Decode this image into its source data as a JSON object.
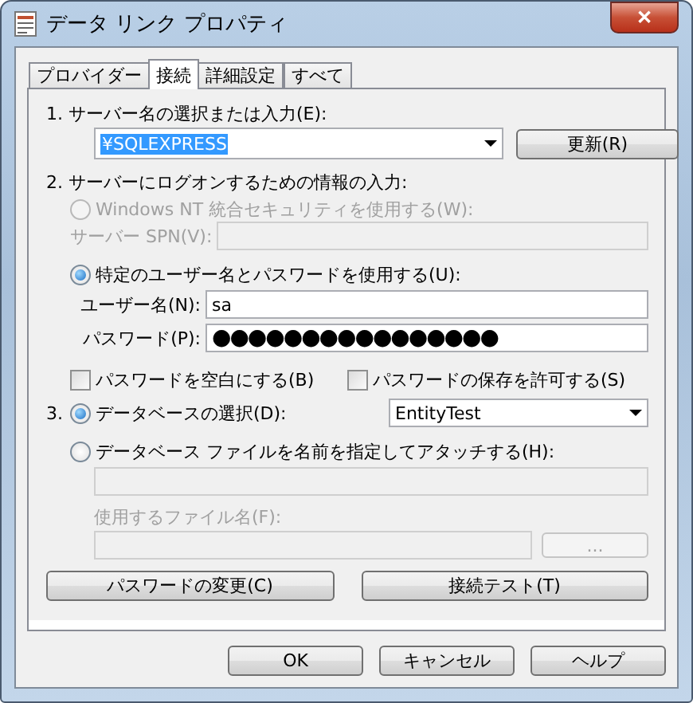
{
  "window": {
    "title": "データ リンク プロパティ",
    "close": "✕"
  },
  "tabs": [
    {
      "label": "プロバイダー",
      "selected": false
    },
    {
      "label": "接続",
      "selected": true
    },
    {
      "label": "詳細設定",
      "selected": false
    },
    {
      "label": "すべて",
      "selected": false
    }
  ],
  "server": {
    "label": "1. サーバー名の選択または入力(E):",
    "value": "¥SQLEXPRESS",
    "refresh_button": "更新(R)"
  },
  "logon": {
    "label": "2. サーバーにログオンするための情報の入力:",
    "options": [
      {
        "label": "Windows NT 統合セキュリティを使用する(W):",
        "selected": false,
        "disabled": true
      },
      {
        "label": "特定のユーザー名とパスワードを使用する(U):",
        "selected": true,
        "disabled": false
      }
    ],
    "spn_label": "サーバー SPN(V):",
    "username_label": "ユーザー名(N):",
    "username": "sa",
    "password_label": "パスワード(P):",
    "password": "●●●●●●●●●●●●●●●●",
    "checkboxes": [
      {
        "label": "パスワードを空白にする(B)",
        "checked": false
      },
      {
        "label": "パスワードの保存を許可する(S)",
        "checked": false
      }
    ]
  },
  "database": {
    "number": "3.",
    "options": [
      {
        "label": "データベースの選択(D):",
        "selected": true
      },
      {
        "label": "データベース ファイルを名前を指定してアタッチする(H):",
        "selected": false
      }
    ],
    "value": "EntityTest",
    "file_label": "使用するファイル名(F):",
    "browse_button": "..."
  },
  "actions": [
    "パスワードの変更(C)",
    "接続テスト(T)"
  ],
  "buttons": [
    "OK",
    "キャンセル",
    "ヘルプ"
  ]
}
